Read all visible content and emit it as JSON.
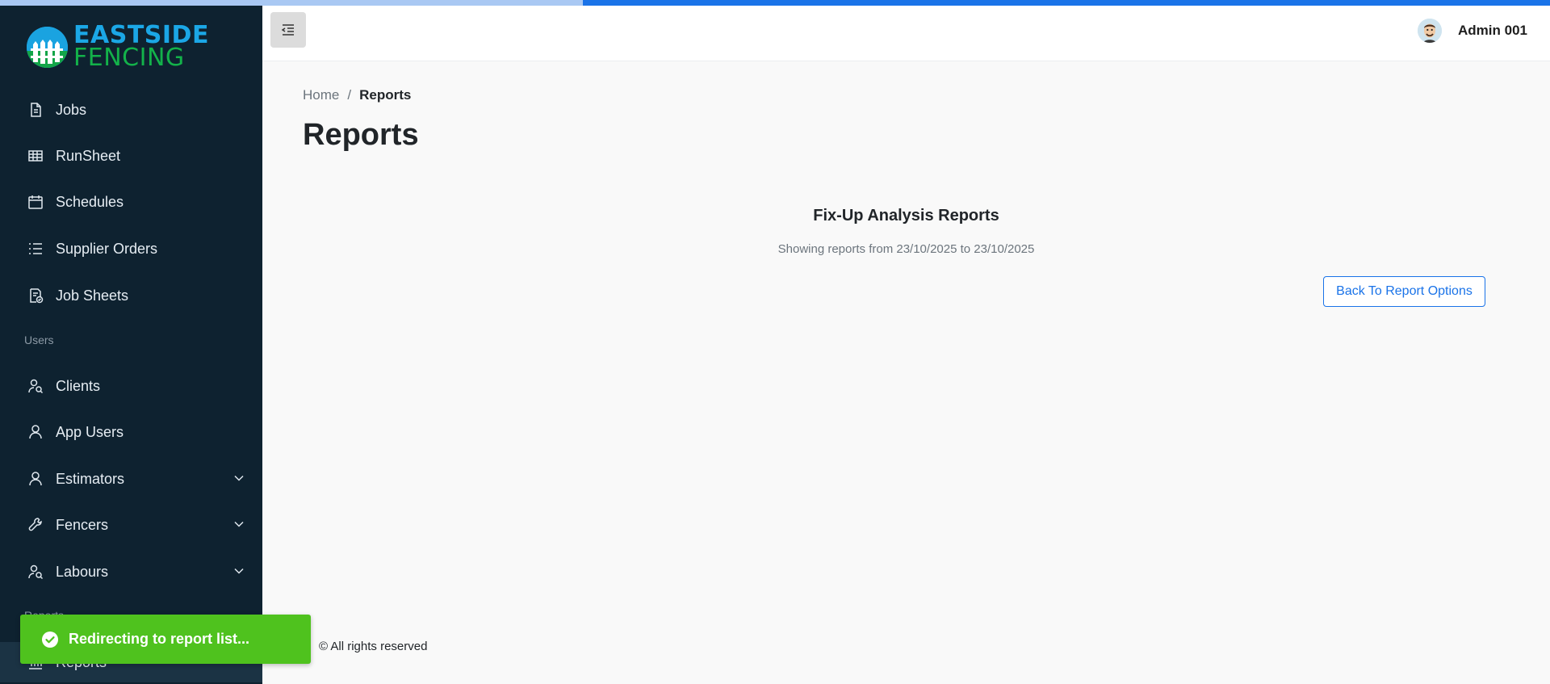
{
  "progress": {
    "value_percent": 62.4,
    "track_color": "#a9c8f3",
    "fill_color": "#1a73e8"
  },
  "brand": {
    "line1": "EASTSIDE",
    "line2": "FENCING"
  },
  "sidebar": {
    "items": [
      {
        "label": "Jobs",
        "icon": "file-icon"
      },
      {
        "label": "RunSheet",
        "icon": "table-icon"
      },
      {
        "label": "Schedules",
        "icon": "calendar-icon"
      },
      {
        "label": "Supplier Orders",
        "icon": "list-icon"
      },
      {
        "label": "Job Sheets",
        "icon": "document-check-icon"
      }
    ],
    "section_users": "Users",
    "user_items": [
      {
        "label": "Clients",
        "icon": "user-search-icon"
      },
      {
        "label": "App Users",
        "icon": "user-icon"
      },
      {
        "label": "Estimators",
        "icon": "user-icon",
        "expandable": true
      },
      {
        "label": "Fencers",
        "icon": "wrench-icon",
        "expandable": true
      },
      {
        "label": "Labours",
        "icon": "user-search-icon",
        "expandable": true
      }
    ],
    "section_reports": "Reports",
    "report_items": [
      {
        "label": "Reports",
        "icon": "chart-icon"
      }
    ]
  },
  "topbar": {
    "user_name": "Admin 001",
    "toggle_icon": "menu-collapse-icon"
  },
  "breadcrumb": {
    "home": "Home",
    "separator": "/",
    "current": "Reports"
  },
  "page": {
    "title": "Reports",
    "report_title": "Fix-Up Analysis Reports",
    "report_subtitle": "Showing reports from 23/10/2025 to 23/10/2025",
    "back_button": "Back To Report Options"
  },
  "footer": {
    "text": "© All rights reserved"
  },
  "toast": {
    "message": "Redirecting to report list...",
    "color": "#4fc21e"
  }
}
